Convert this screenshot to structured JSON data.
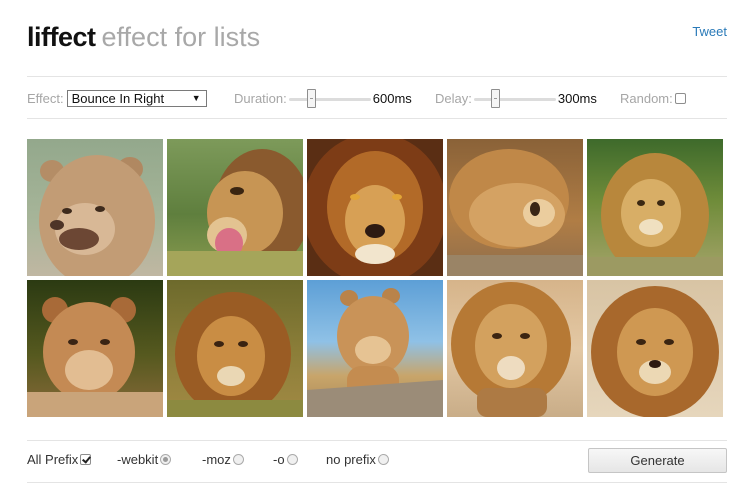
{
  "header": {
    "brand": "liffect",
    "tagline": "effect for lists",
    "tweet_label": "Tweet"
  },
  "controls": {
    "effect": {
      "label": "Effect:",
      "selected": "Bounce In Right"
    },
    "duration": {
      "label": "Duration:",
      "value": "600ms"
    },
    "delay": {
      "label": "Delay:",
      "value": "300ms"
    },
    "random": {
      "label": "Random:",
      "checked": false
    }
  },
  "gallery": {
    "images": [
      {
        "name": "lioness-portrait"
      },
      {
        "name": "lion-yawning"
      },
      {
        "name": "lion-dark-mane-closeup"
      },
      {
        "name": "lion-sleeping"
      },
      {
        "name": "lion-sitting-grass"
      },
      {
        "name": "lioness-lying"
      },
      {
        "name": "lion-in-grass"
      },
      {
        "name": "lion-cub-walking"
      },
      {
        "name": "lion-walking-toward"
      },
      {
        "name": "lion-mane-portrait"
      }
    ]
  },
  "footer": {
    "all_prefix": {
      "label": "All Prefix",
      "checked": true
    },
    "prefixes": [
      {
        "label": "-webkit",
        "checked": true
      },
      {
        "label": "-moz",
        "checked": false
      },
      {
        "label": "-o",
        "checked": false
      },
      {
        "label": "no prefix",
        "checked": false
      }
    ],
    "generate_label": "Generate"
  },
  "colors": {
    "brand_text": "#111111",
    "tagline_text": "#a8a8a8",
    "link": "#2a7ab8",
    "label_gray": "#a6a6a6"
  }
}
